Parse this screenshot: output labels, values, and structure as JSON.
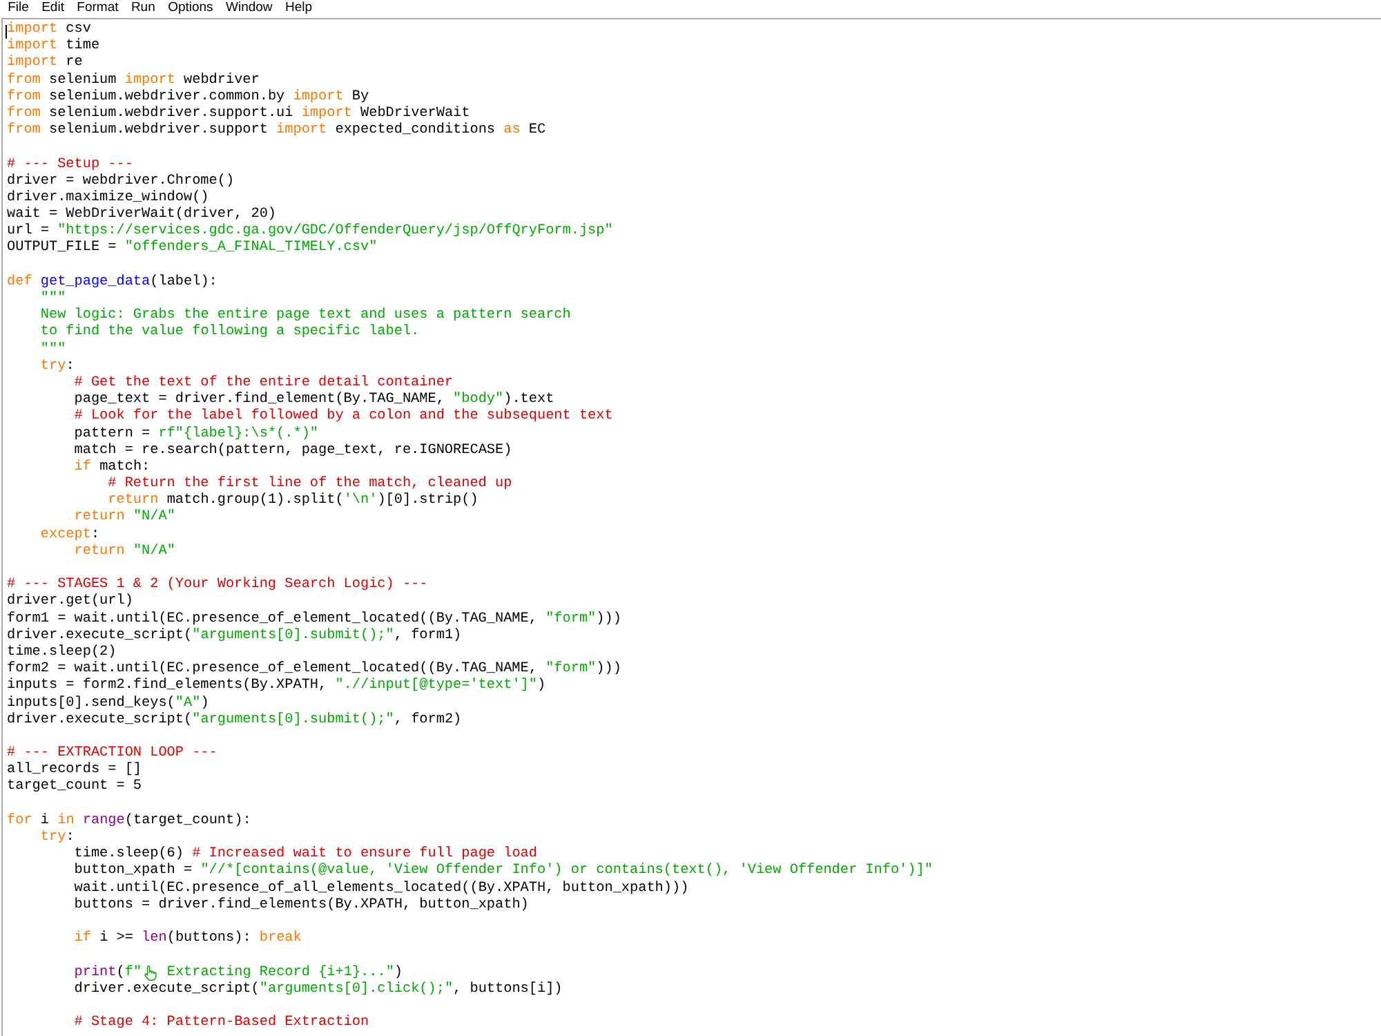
{
  "menu_bar": {
    "items": [
      "File",
      "Edit",
      "Format",
      "Run",
      "Options",
      "Window",
      "Help"
    ]
  },
  "editor": {
    "blocks": [
      {
        "lines": [
          {
            "tokens": [
              {
                "kind": "keyword",
                "text": "import"
              },
              {
                "kind": "plain",
                "text": " csv"
              }
            ]
          },
          {
            "tokens": [
              {
                "kind": "keyword",
                "text": "import"
              },
              {
                "kind": "plain",
                "text": " time"
              }
            ]
          },
          {
            "tokens": [
              {
                "kind": "keyword",
                "text": "import"
              },
              {
                "kind": "plain",
                "text": " re"
              }
            ]
          },
          {
            "tokens": [
              {
                "kind": "keyword",
                "text": "from"
              },
              {
                "kind": "plain",
                "text": " selenium "
              },
              {
                "kind": "keyword",
                "text": "import"
              },
              {
                "kind": "plain",
                "text": " webdriver"
              }
            ]
          },
          {
            "tokens": [
              {
                "kind": "keyword",
                "text": "from"
              },
              {
                "kind": "plain",
                "text": " selenium.webdriver.common.by "
              },
              {
                "kind": "keyword",
                "text": "import"
              },
              {
                "kind": "plain",
                "text": " By"
              }
            ]
          },
          {
            "tokens": [
              {
                "kind": "keyword",
                "text": "from"
              },
              {
                "kind": "plain",
                "text": " selenium.webdriver.support.ui "
              },
              {
                "kind": "keyword",
                "text": "import"
              },
              {
                "kind": "plain",
                "text": " WebDriverWait"
              }
            ]
          },
          {
            "tokens": [
              {
                "kind": "keyword",
                "text": "from"
              },
              {
                "kind": "plain",
                "text": " selenium.webdriver.support "
              },
              {
                "kind": "keyword",
                "text": "import"
              },
              {
                "kind": "plain",
                "text": " expected_conditions "
              },
              {
                "kind": "keyword",
                "text": "as"
              },
              {
                "kind": "plain",
                "text": " EC"
              }
            ]
          }
        ]
      },
      {
        "lines": [
          {
            "tokens": [
              {
                "kind": "comment",
                "text": "# --- Setup ---"
              }
            ]
          },
          {
            "tokens": [
              {
                "kind": "plain",
                "text": "driver = webdriver.Chrome()"
              }
            ]
          },
          {
            "tokens": [
              {
                "kind": "plain",
                "text": "driver.maximize_window()"
              }
            ]
          },
          {
            "tokens": [
              {
                "kind": "plain",
                "text": "wait = WebDriverWait(driver, 20)"
              }
            ]
          },
          {
            "tokens": [
              {
                "kind": "plain",
                "text": "url = "
              },
              {
                "kind": "string",
                "text": "\"https://services.gdc.ga.gov/GDC/OffenderQuery/jsp/OffQryForm.jsp\""
              }
            ]
          },
          {
            "tokens": [
              {
                "kind": "plain",
                "text": "OUTPUT_FILE = "
              },
              {
                "kind": "string",
                "text": "\"offenders_A_FINAL_TIMELY.csv\""
              }
            ]
          }
        ]
      },
      {
        "lines": [
          {
            "tokens": [
              {
                "kind": "keyword",
                "text": "def "
              },
              {
                "kind": "definition",
                "text": "get_page_data"
              },
              {
                "kind": "plain",
                "text": "(label):"
              }
            ]
          },
          {
            "tokens": [
              {
                "kind": "string",
                "text": "    \"\"\""
              }
            ]
          },
          {
            "tokens": [
              {
                "kind": "string",
                "text": "    New logic: Grabs the entire page text and uses a pattern search"
              }
            ]
          },
          {
            "tokens": [
              {
                "kind": "string",
                "text": "    to find the value following a specific label."
              }
            ]
          },
          {
            "tokens": [
              {
                "kind": "string",
                "text": "    \"\"\""
              }
            ]
          },
          {
            "tokens": [
              {
                "kind": "keyword",
                "text": "    try"
              },
              {
                "kind": "plain",
                "text": ":"
              }
            ]
          },
          {
            "tokens": [
              {
                "kind": "comment",
                "text": "        # Get the text of the entire detail container"
              }
            ]
          },
          {
            "tokens": [
              {
                "kind": "plain",
                "text": "        page_text = driver.find_element(By.TAG_NAME, "
              },
              {
                "kind": "string",
                "text": "\"body\""
              },
              {
                "kind": "plain",
                "text": ").text"
              }
            ]
          },
          {
            "tokens": [
              {
                "kind": "comment",
                "text": "        # Look for the label followed by a colon and the subsequent text"
              }
            ]
          },
          {
            "tokens": [
              {
                "kind": "plain",
                "text": "        pattern = "
              },
              {
                "kind": "string",
                "text": "rf\"{label}:\\s*(.*)\""
              }
            ]
          },
          {
            "tokens": [
              {
                "kind": "plain",
                "text": "        match = re.search(pattern, page_text, re.IGNORECASE)"
              }
            ]
          },
          {
            "tokens": [
              {
                "kind": "keyword",
                "text": "        if"
              },
              {
                "kind": "plain",
                "text": " match:"
              }
            ]
          },
          {
            "tokens": [
              {
                "kind": "comment",
                "text": "            # Return the first line of the match, cleaned up"
              }
            ]
          },
          {
            "tokens": [
              {
                "kind": "keyword",
                "text": "            return"
              },
              {
                "kind": "plain",
                "text": " match.group(1).split("
              },
              {
                "kind": "string",
                "text": "'\\n'"
              },
              {
                "kind": "plain",
                "text": ")[0].strip()"
              }
            ]
          },
          {
            "tokens": [
              {
                "kind": "keyword",
                "text": "        return "
              },
              {
                "kind": "string",
                "text": "\"N/A\""
              }
            ]
          },
          {
            "tokens": [
              {
                "kind": "keyword",
                "text": "    except"
              },
              {
                "kind": "plain",
                "text": ":"
              }
            ]
          },
          {
            "tokens": [
              {
                "kind": "keyword",
                "text": "        return "
              },
              {
                "kind": "string",
                "text": "\"N/A\""
              }
            ]
          }
        ]
      },
      {
        "lines": [
          {
            "tokens": [
              {
                "kind": "comment",
                "text": "# --- STAGES 1 & 2 (Your Working Search Logic) ---"
              }
            ]
          },
          {
            "tokens": [
              {
                "kind": "plain",
                "text": "driver.get(url)"
              }
            ]
          },
          {
            "tokens": [
              {
                "kind": "plain",
                "text": "form1 = wait.until(EC.presence_of_element_located((By.TAG_NAME, "
              },
              {
                "kind": "string",
                "text": "\"form\""
              },
              {
                "kind": "plain",
                "text": ")))"
              }
            ]
          },
          {
            "tokens": [
              {
                "kind": "plain",
                "text": "driver.execute_script("
              },
              {
                "kind": "string",
                "text": "\"arguments[0].submit();\""
              },
              {
                "kind": "plain",
                "text": ", form1)"
              }
            ]
          },
          {
            "tokens": [
              {
                "kind": "plain",
                "text": "time.sleep(2)"
              }
            ]
          },
          {
            "tokens": [
              {
                "kind": "plain",
                "text": "form2 = wait.until(EC.presence_of_element_located((By.TAG_NAME, "
              },
              {
                "kind": "string",
                "text": "\"form\""
              },
              {
                "kind": "plain",
                "text": ")))"
              }
            ]
          },
          {
            "tokens": [
              {
                "kind": "plain",
                "text": "inputs = form2.find_elements(By.XPATH, "
              },
              {
                "kind": "string",
                "text": "\".//input[@type='text']\""
              },
              {
                "kind": "plain",
                "text": ")"
              }
            ]
          },
          {
            "tokens": [
              {
                "kind": "plain",
                "text": "inputs[0].send_keys("
              },
              {
                "kind": "string",
                "text": "\"A\""
              },
              {
                "kind": "plain",
                "text": ")"
              }
            ]
          },
          {
            "tokens": [
              {
                "kind": "plain",
                "text": "driver.execute_script("
              },
              {
                "kind": "string",
                "text": "\"arguments[0].submit();\""
              },
              {
                "kind": "plain",
                "text": ", form2)"
              }
            ]
          }
        ]
      },
      {
        "lines": [
          {
            "tokens": [
              {
                "kind": "comment",
                "text": "# --- EXTRACTION LOOP ---"
              }
            ]
          },
          {
            "tokens": [
              {
                "kind": "plain",
                "text": "all_records = []"
              }
            ]
          },
          {
            "tokens": [
              {
                "kind": "plain",
                "text": "target_count = 5"
              }
            ]
          }
        ]
      },
      {
        "lines": [
          {
            "tokens": [
              {
                "kind": "keyword",
                "text": "for"
              },
              {
                "kind": "plain",
                "text": " i "
              },
              {
                "kind": "keyword",
                "text": "in "
              },
              {
                "kind": "builtin",
                "text": "range"
              },
              {
                "kind": "plain",
                "text": "(target_count):"
              }
            ]
          },
          {
            "tokens": [
              {
                "kind": "keyword",
                "text": "    try"
              },
              {
                "kind": "plain",
                "text": ":"
              }
            ]
          },
          {
            "tokens": [
              {
                "kind": "plain",
                "text": "        time.sleep(6) "
              },
              {
                "kind": "comment",
                "text": "# Increased wait to ensure full page load"
              }
            ]
          },
          {
            "tokens": [
              {
                "kind": "plain",
                "text": "        button_xpath = "
              },
              {
                "kind": "string",
                "text": "\"//*[contains(@value, 'View Offender Info') or contains(text(), 'View Offender Info')]\""
              }
            ]
          },
          {
            "tokens": [
              {
                "kind": "plain",
                "text": "        wait.until(EC.presence_of_all_elements_located((By.XPATH, button_xpath)))"
              }
            ]
          },
          {
            "tokens": [
              {
                "kind": "plain",
                "text": "        buttons = driver.find_elements(By.XPATH, button_xpath)"
              }
            ]
          }
        ]
      },
      {
        "lines": [
          {
            "tokens": [
              {
                "kind": "keyword",
                "text": "        if"
              },
              {
                "kind": "plain",
                "text": " i >= "
              },
              {
                "kind": "builtin",
                "text": "len"
              },
              {
                "kind": "plain",
                "text": "(buttons): "
              },
              {
                "kind": "keyword",
                "text": "break"
              }
            ]
          }
        ]
      },
      {
        "lines": [
          {
            "tokens": [
              {
                "kind": "builtin",
                "text": "        print"
              },
              {
                "kind": "plain",
                "text": "("
              },
              {
                "kind": "string",
                "text": "f\""
              },
              {
                "kind": "icon"
              },
              {
                "kind": "string",
                "text": " Extracting Record {i+1}...\""
              },
              {
                "kind": "plain",
                "text": ")"
              }
            ]
          },
          {
            "tokens": [
              {
                "kind": "plain",
                "text": "        driver.execute_script("
              },
              {
                "kind": "string",
                "text": "\"arguments[0].click();\""
              },
              {
                "kind": "plain",
                "text": ", buttons[i])"
              }
            ]
          }
        ]
      },
      {
        "lines": [
          {
            "tokens": [
              {
                "kind": "comment",
                "text": "        # Stage 4: Pattern-Based Extraction"
              }
            ]
          }
        ]
      }
    ]
  }
}
